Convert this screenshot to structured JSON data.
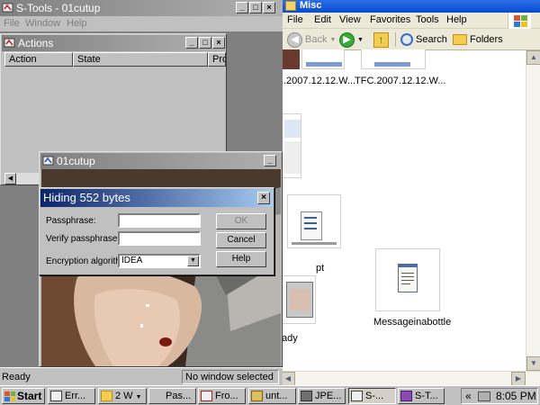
{
  "explorer": {
    "title": "Misc",
    "menu": [
      "File",
      "Edit",
      "View",
      "Favorites",
      "Tools",
      "Help"
    ],
    "toolbar": {
      "back": "Back",
      "search": "Search",
      "folders": "Folders"
    },
    "files": [
      {
        "caption": ".2007.12.12.W..."
      },
      {
        "caption": "TFC.2007.12.12.W..."
      },
      {
        "caption": "pt"
      },
      {
        "caption": "ady"
      },
      {
        "caption": "Messageinabottle"
      }
    ]
  },
  "stools": {
    "title": "S-Tools - 01cutup",
    "menu": [
      "File",
      "Window",
      "Help"
    ],
    "actions_window": {
      "title": "Actions",
      "columns": [
        "Action",
        "State",
        "Pro"
      ]
    },
    "image_window": {
      "title": "01cutup"
    },
    "status": {
      "left": "Ready",
      "right": "No window selected"
    }
  },
  "dialog": {
    "title": "Hiding 552 bytes",
    "passphrase_label": "Passphrase:",
    "verify_label": "Verify passphrase:",
    "algorithm_label": "Encryption algorithm:",
    "algorithm_value": "IDEA",
    "ok_label": "OK",
    "cancel_label": "Cancel",
    "help_label": "Help"
  },
  "taskbar": {
    "start_label": "Start",
    "buttons": [
      "Err...",
      "2 W",
      "Pas...",
      "Fro...",
      "unt...",
      "JPE...",
      "S-...",
      "S-T..."
    ],
    "tray_arrow": "«",
    "time": "8:05 PM"
  }
}
